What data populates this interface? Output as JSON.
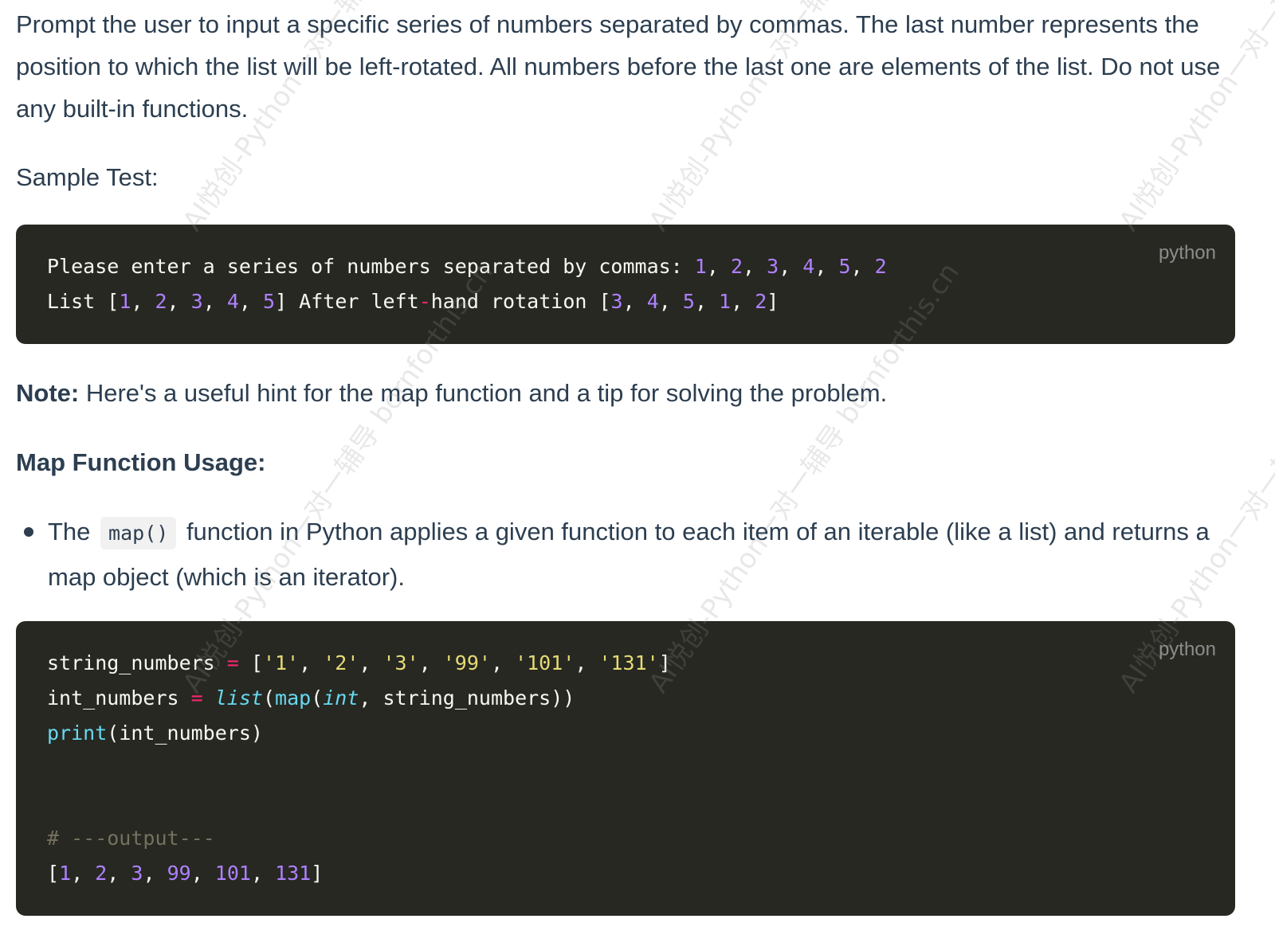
{
  "intro": "Prompt the user to input a specific series of numbers separated by commas. The last number represents the position to which the list will be left-rotated. All numbers before the last one are elements of the list. Do not use any built-in functions.",
  "sample_test_label": "Sample Test:",
  "code_block_1": {
    "language": "python",
    "lines": [
      [
        {
          "t": "Please enter a series of numbers separated by commas: ",
          "c": ""
        },
        {
          "t": "1",
          "c": "num"
        },
        {
          "t": ", ",
          "c": ""
        },
        {
          "t": "2",
          "c": "num"
        },
        {
          "t": ", ",
          "c": ""
        },
        {
          "t": "3",
          "c": "num"
        },
        {
          "t": ", ",
          "c": ""
        },
        {
          "t": "4",
          "c": "num"
        },
        {
          "t": ", ",
          "c": ""
        },
        {
          "t": "5",
          "c": "num"
        },
        {
          "t": ", ",
          "c": ""
        },
        {
          "t": "2",
          "c": "num"
        }
      ],
      [
        {
          "t": "List [",
          "c": ""
        },
        {
          "t": "1",
          "c": "num"
        },
        {
          "t": ", ",
          "c": ""
        },
        {
          "t": "2",
          "c": "num"
        },
        {
          "t": ", ",
          "c": ""
        },
        {
          "t": "3",
          "c": "num"
        },
        {
          "t": ", ",
          "c": ""
        },
        {
          "t": "4",
          "c": "num"
        },
        {
          "t": ", ",
          "c": ""
        },
        {
          "t": "5",
          "c": "num"
        },
        {
          "t": "] After left",
          "c": ""
        },
        {
          "t": "-",
          "c": "op"
        },
        {
          "t": "hand rotation [",
          "c": ""
        },
        {
          "t": "3",
          "c": "num"
        },
        {
          "t": ", ",
          "c": ""
        },
        {
          "t": "4",
          "c": "num"
        },
        {
          "t": ", ",
          "c": ""
        },
        {
          "t": "5",
          "c": "num"
        },
        {
          "t": ", ",
          "c": ""
        },
        {
          "t": "1",
          "c": "num"
        },
        {
          "t": ", ",
          "c": ""
        },
        {
          "t": "2",
          "c": "num"
        },
        {
          "t": "]",
          "c": ""
        }
      ]
    ]
  },
  "note": {
    "label": "Note:",
    "text": " Here's a useful hint for the map function and a tip for solving the problem."
  },
  "map_heading": "Map Function Usage:",
  "bullet": {
    "before": "The",
    "code": "map()",
    "after": "function in Python applies a given function to each item of an iterable (like a list) and returns a map object (which is an iterator)."
  },
  "code_block_2": {
    "language": "python",
    "lines": [
      [
        {
          "t": "string_numbers ",
          "c": ""
        },
        {
          "t": "=",
          "c": "op"
        },
        {
          "t": " [",
          "c": ""
        },
        {
          "t": "'1'",
          "c": "str"
        },
        {
          "t": ", ",
          "c": ""
        },
        {
          "t": "'2'",
          "c": "str"
        },
        {
          "t": ", ",
          "c": ""
        },
        {
          "t": "'3'",
          "c": "str"
        },
        {
          "t": ", ",
          "c": ""
        },
        {
          "t": "'99'",
          "c": "str"
        },
        {
          "t": ", ",
          "c": ""
        },
        {
          "t": "'101'",
          "c": "str"
        },
        {
          "t": ", ",
          "c": ""
        },
        {
          "t": "'131'",
          "c": "str"
        },
        {
          "t": "]",
          "c": ""
        }
      ],
      [
        {
          "t": "int_numbers ",
          "c": ""
        },
        {
          "t": "=",
          "c": "op"
        },
        {
          "t": " ",
          "c": ""
        },
        {
          "t": "list",
          "c": "italic-fn"
        },
        {
          "t": "(",
          "c": ""
        },
        {
          "t": "map",
          "c": "fn"
        },
        {
          "t": "(",
          "c": ""
        },
        {
          "t": "int",
          "c": "italic-fn"
        },
        {
          "t": ", string_numbers))",
          "c": ""
        }
      ],
      [
        {
          "t": "print",
          "c": "fn"
        },
        {
          "t": "(int_numbers)",
          "c": ""
        }
      ],
      [],
      [],
      [
        {
          "t": "# ---output---",
          "c": "cmt"
        }
      ],
      [
        {
          "t": "[",
          "c": ""
        },
        {
          "t": "1",
          "c": "num"
        },
        {
          "t": ", ",
          "c": ""
        },
        {
          "t": "2",
          "c": "num"
        },
        {
          "t": ", ",
          "c": ""
        },
        {
          "t": "3",
          "c": "num"
        },
        {
          "t": ", ",
          "c": ""
        },
        {
          "t": "99",
          "c": "num"
        },
        {
          "t": ", ",
          "c": ""
        },
        {
          "t": "101",
          "c": "num"
        },
        {
          "t": ", ",
          "c": ""
        },
        {
          "t": "131",
          "c": "num"
        },
        {
          "t": "]",
          "c": ""
        }
      ]
    ]
  },
  "watermarks": [
    "AI悦创-Python一对一辅导 bornforthis.cn"
  ]
}
